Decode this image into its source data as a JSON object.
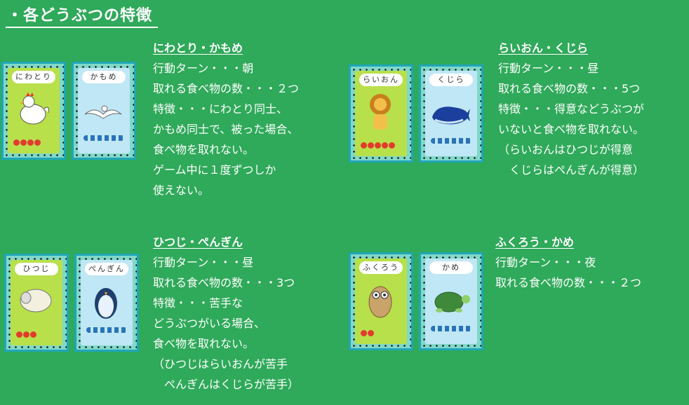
{
  "title": "・各どうぶつの特徴",
  "colors": {
    "background": "#2fa95a",
    "card_border": "#1fa6b8",
    "green_card": "#b8e04a",
    "blue_card": "#bfe7f6",
    "apple": "#e23b2e"
  },
  "sections": [
    {
      "name": "にわとり・かもめ",
      "cards": [
        {
          "label": "にわとり",
          "icon": "chicken-icon",
          "apples": 4
        },
        {
          "label": "かもめ",
          "icon": "seagull-icon"
        }
      ],
      "lines": [
        "行動ターン・・・朝",
        "取れる食べ物の数・・・２つ",
        "特徴・・・にわとり同士、",
        "かもめ同士で、被った場合、",
        "食べ物を取れない。",
        "ゲーム中に１度ずつしか",
        "使えない。"
      ]
    },
    {
      "name": "らいおん・くじら",
      "cards": [
        {
          "label": "らいおん",
          "icon": "lion-icon",
          "apples": 5
        },
        {
          "label": "くじら",
          "icon": "whale-icon"
        }
      ],
      "lines": [
        "行動ターン・・・昼",
        "取れる食べ物の数・・・5つ",
        "特徴・・・得意などうぶつが",
        "いないと食べ物を取れない。",
        "（らいおんはひつじが得意",
        "　くじらはぺんぎんが得意）"
      ]
    },
    {
      "name": "ひつじ・ぺんぎん",
      "cards": [
        {
          "label": "ひつじ",
          "icon": "sheep-icon",
          "apples": 3
        },
        {
          "label": "ぺんぎん",
          "icon": "penguin-icon"
        }
      ],
      "lines": [
        "行動ターン・・・昼",
        "取れる食べ物の数・・・3つ",
        "特徴・・・苦手な",
        "どうぶつがいる場合、",
        "食べ物を取れない。",
        "（ひつじはらいおんが苦手",
        "　ぺんぎんはくじらが苦手）"
      ]
    },
    {
      "name": "ふくろう・かめ",
      "cards": [
        {
          "label": "ふくろう",
          "icon": "owl-icon",
          "apples": 2
        },
        {
          "label": "かめ",
          "icon": "turtle-icon"
        }
      ],
      "lines": [
        "行動ターン・・・夜",
        "取れる食べ物の数・・・２つ"
      ]
    }
  ]
}
